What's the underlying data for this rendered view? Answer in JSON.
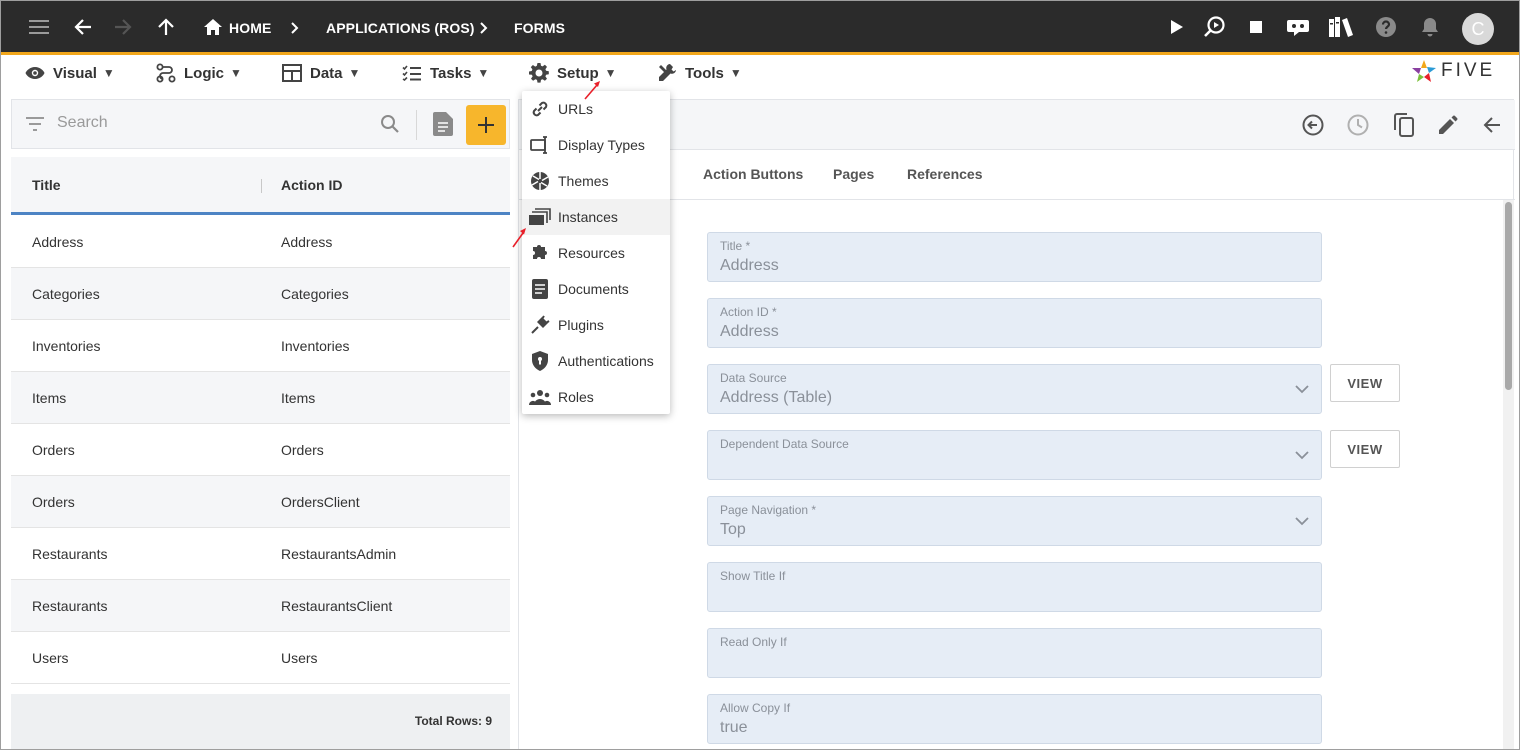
{
  "topbar": {
    "breadcrumbs": [
      {
        "label": "HOME"
      },
      {
        "label": "APPLICATIONS (ROS)"
      },
      {
        "label": "FORMS"
      }
    ],
    "avatar_initial": "C"
  },
  "menubar": {
    "items": [
      {
        "label": "Visual",
        "caret": "▼"
      },
      {
        "label": "Logic",
        "caret": "▼"
      },
      {
        "label": "Data",
        "caret": "▼"
      },
      {
        "label": "Tasks",
        "caret": "▼"
      },
      {
        "label": "Setup",
        "caret": "▼"
      },
      {
        "label": "Tools",
        "caret": "▼"
      }
    ],
    "logo_text": "FIVE"
  },
  "setup_menu": {
    "items": [
      {
        "label": "URLs",
        "icon": "link-icon"
      },
      {
        "label": "Display Types",
        "icon": "display-type-icon"
      },
      {
        "label": "Themes",
        "icon": "aperture-icon"
      },
      {
        "label": "Instances",
        "icon": "instances-icon"
      },
      {
        "label": "Resources",
        "icon": "puzzle-icon"
      },
      {
        "label": "Documents",
        "icon": "document-icon"
      },
      {
        "label": "Plugins",
        "icon": "plug-icon"
      },
      {
        "label": "Authentications",
        "icon": "shield-icon"
      },
      {
        "label": "Roles",
        "icon": "people-icon"
      }
    ]
  },
  "list": {
    "search_placeholder": "Search",
    "columns": [
      "Title",
      "Action ID"
    ],
    "rows": [
      [
        "Address",
        "Address"
      ],
      [
        "Categories",
        "Categories"
      ],
      [
        "Inventories",
        "Inventories"
      ],
      [
        "Items",
        "Items"
      ],
      [
        "Orders",
        "Orders"
      ],
      [
        "Orders",
        "OrdersClient"
      ],
      [
        "Restaurants",
        "RestaurantsAdmin"
      ],
      [
        "Restaurants",
        "RestaurantsClient"
      ],
      [
        "Users",
        "Users"
      ]
    ],
    "total_rows": "Total Rows: 9"
  },
  "detail": {
    "tabs": [
      "Action Buttons",
      "Pages",
      "References"
    ],
    "fields": {
      "title": {
        "label": "Title *",
        "value": "Address"
      },
      "action_id": {
        "label": "Action ID *",
        "value": "Address"
      },
      "data_source": {
        "label": "Data Source",
        "value": "Address (Table)"
      },
      "dependent_data_source": {
        "label": "Dependent Data Source",
        "value": ""
      },
      "page_navigation": {
        "label": "Page Navigation *",
        "value": "Top"
      },
      "show_title_if": {
        "label": "Show Title If",
        "value": ""
      },
      "read_only_if": {
        "label": "Read Only If",
        "value": ""
      },
      "allow_copy_if": {
        "label": "Allow Copy If",
        "value": "true"
      }
    },
    "view_label": "VIEW"
  },
  "colors": {
    "topbar_bg": "#2b2b2b",
    "accent": "#f7b62c",
    "field_bg": "#e6edf6",
    "header_underline": "#4d84c4",
    "annotation": "#e8202a"
  }
}
